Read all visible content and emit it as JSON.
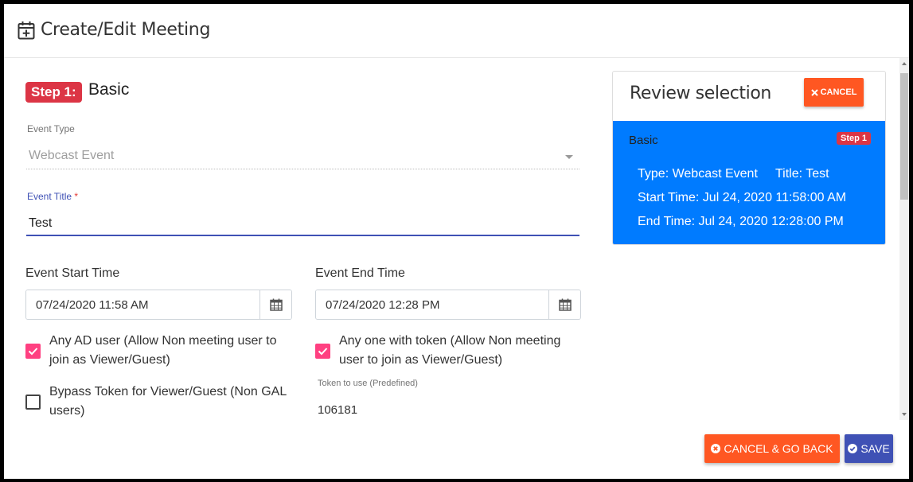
{
  "header": {
    "title": "Create/Edit Meeting",
    "icon": "calendar-plus-icon"
  },
  "step": {
    "badge": "Step 1:",
    "title": "Basic"
  },
  "event_type": {
    "label": "Event Type",
    "value": "Webcast Event"
  },
  "event_title": {
    "label": "Event Title",
    "required_mark": "*",
    "value": "Test"
  },
  "start": {
    "label": "Event Start Time",
    "value": "07/24/2020 11:58 AM"
  },
  "end": {
    "label": "Event End Time",
    "value": "07/24/2020 12:28 PM"
  },
  "options": {
    "any_ad_user": {
      "line1": "Any AD user (Allow Non meeting user to",
      "line2": "join as Viewer/Guest)",
      "checked": true
    },
    "bypass_token": {
      "line1": "Bypass Token for Viewer/Guest (Non GAL",
      "line2": "users)",
      "checked": false
    },
    "any_token": {
      "line1": "Any one with token (Allow Non meeting",
      "line2": "user to join as Viewer/Guest)",
      "checked": true
    }
  },
  "token": {
    "label": "Token to use (Predefined)",
    "value": "106181"
  },
  "review": {
    "title": "Review selection",
    "cancel_label": "CANCEL",
    "section": "Basic",
    "badge": "Step 1",
    "type_line": "Type: Webcast Event",
    "title_line": "Title: Test",
    "start_line": "Start Time: Jul 24, 2020 11:58:00 AM",
    "end_line": "End Time: Jul 24, 2020 12:28:00 PM"
  },
  "footer": {
    "cancel_back_label": "CANCEL & GO BACK",
    "save_label": "SAVE"
  },
  "colors": {
    "accent": "#3f51b5",
    "danger": "#dc3545",
    "orange": "#ff5722",
    "review_bg": "#007bff",
    "checkbox": "#ff4081"
  }
}
